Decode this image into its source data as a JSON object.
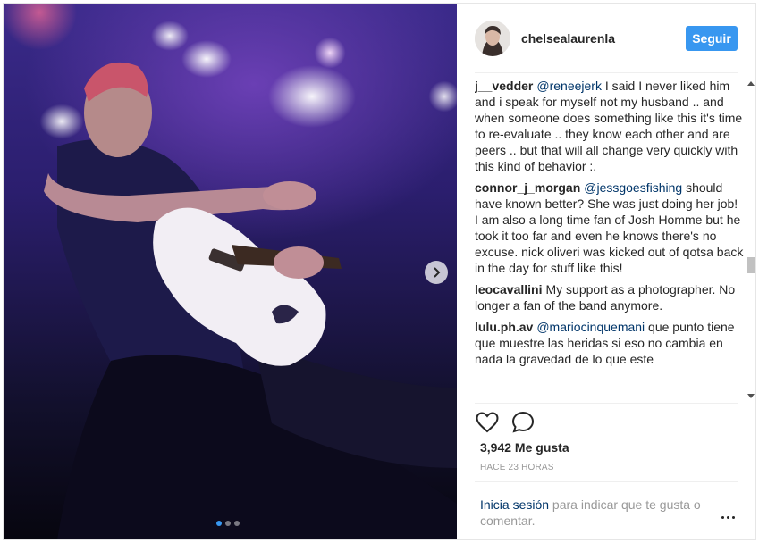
{
  "post": {
    "author": "chelsealaurenla",
    "follow_label": "Seguir",
    "likes": "3,942 Me gusta",
    "time": "HACE 23 HORAS",
    "carousel": {
      "total": 3,
      "active_index": 0
    }
  },
  "comments": [
    {
      "user": "j__vedder",
      "mention": "@reneejerk",
      "text": " I said I never liked him and i speak for myself not my husband .. and when someone does something like this it's time to re-evaluate .. they know each other and are peers .. but that will all change very quickly with this kind of behavior :."
    },
    {
      "user": "connor_j_morgan",
      "mention": "@jessgoesfishing",
      "text": " should have known better? She was just doing her job! I am also a long time fan of Josh Homme but he took it too far and even he knows there's no excuse. nick oliveri was kicked out of qotsa back in the day for stuff like this!"
    },
    {
      "user": "leocavallini",
      "mention": "",
      "text": "My support as a photographer. No longer a fan of the band anymore."
    },
    {
      "user": "lulu.ph.av",
      "mention": "@mariocinquemani",
      "text": " que punto tiene que muestre las heridas si eso no cambia en nada la gravedad de lo que este"
    }
  ],
  "footer": {
    "login_link": "Inicia sesión",
    "login_rest": " para indicar que te gusta o comentar."
  },
  "colors": {
    "accent": "#3897f0",
    "link": "#003569",
    "muted": "#999999"
  },
  "icons": {
    "next": "chevron-right-icon",
    "like": "heart-icon",
    "comment": "speech-bubble-icon",
    "more": "ellipsis-icon"
  }
}
